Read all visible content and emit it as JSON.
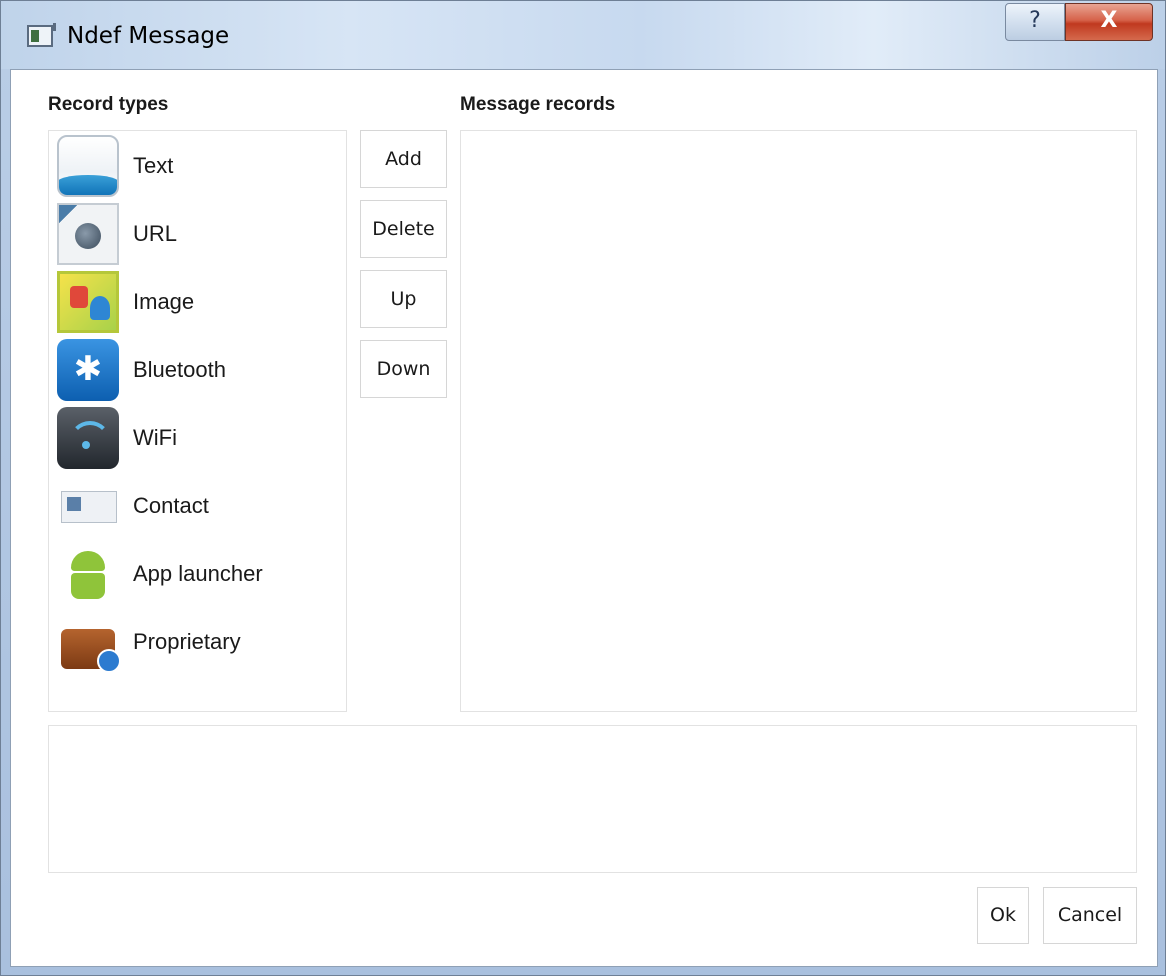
{
  "window": {
    "title": "Ndef Message",
    "help_glyph": "?",
    "close_glyph": "X"
  },
  "record_types": {
    "heading": "Record types",
    "items": [
      {
        "label": "Text",
        "icon": "text-document-icon"
      },
      {
        "label": "URL",
        "icon": "url-globe-icon"
      },
      {
        "label": "Image",
        "icon": "image-picture-icon"
      },
      {
        "label": "Bluetooth",
        "icon": "bluetooth-icon"
      },
      {
        "label": "WiFi",
        "icon": "wifi-icon"
      },
      {
        "label": "Contact",
        "icon": "contact-card-icon"
      },
      {
        "label": "App launcher",
        "icon": "android-icon"
      },
      {
        "label": "Proprietary",
        "icon": "briefcase-info-icon"
      }
    ]
  },
  "actions": {
    "add": "Add",
    "delete": "Delete",
    "up": "Up",
    "down": "Down"
  },
  "message_records": {
    "heading": "Message records"
  },
  "footer": {
    "ok": "Ok",
    "cancel": "Cancel"
  },
  "colors": {
    "title_bar": "#c9dbee",
    "close_button": "#c0391f",
    "bluetooth": "#1f75cc",
    "wifi_arc": "#5db8e8"
  }
}
